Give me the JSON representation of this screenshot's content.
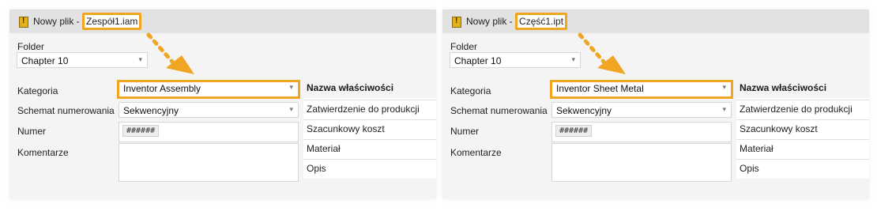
{
  "colors": {
    "highlight": "#f0a623",
    "titlebar": "#e2e2e2",
    "panel": "#f4f4f4"
  },
  "panels": [
    {
      "title_prefix": "Nowy plik -",
      "title_file": "Zespół1.iam",
      "folder_label": "Folder",
      "folder_value": "Chapter 10",
      "kategoria_label": "Kategoria",
      "kategoria_value": "Inventor Assembly",
      "schemat_label": "Schemat numerowania",
      "schemat_value": "Sekwencyjny",
      "numer_label": "Numer",
      "numer_value": "######",
      "komentarze_label": "Komentarze",
      "props_header": "Nazwa właściwości",
      "props": [
        "Zatwierdzenie do produkcji",
        "Szacunkowy koszt",
        "Materiał",
        "Opis"
      ]
    },
    {
      "title_prefix": "Nowy plik -",
      "title_file": "Część1.ipt",
      "folder_label": "Folder",
      "folder_value": "Chapter 10",
      "kategoria_label": "Kategoria",
      "kategoria_value": "Inventor Sheet Metal",
      "schemat_label": "Schemat numerowania",
      "schemat_value": "Sekwencyjny",
      "numer_label": "Numer",
      "numer_value": "######",
      "komentarze_label": "Komentarze",
      "props_header": "Nazwa właściwości",
      "props": [
        "Zatwierdzenie do produkcji",
        "Szacunkowy koszt",
        "Materiał",
        "Opis"
      ]
    }
  ]
}
